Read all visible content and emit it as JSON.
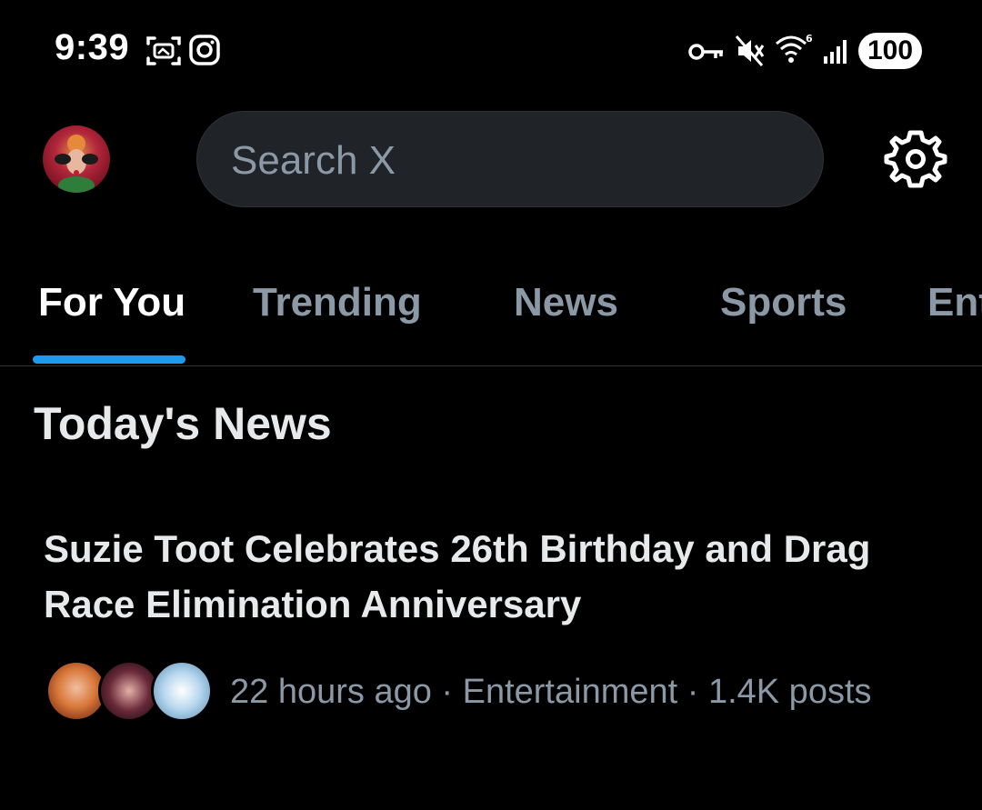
{
  "status_bar": {
    "time": "9:39",
    "battery": "100",
    "icons": [
      "screenshot-icon",
      "instagram-icon",
      "vpn-key-icon",
      "vibrate-off-icon",
      "wifi-6-icon",
      "signal-icon"
    ]
  },
  "header": {
    "search_placeholder": "Search X",
    "avatar_icon": "profile-avatar",
    "settings_icon": "gear-icon"
  },
  "tabs": [
    {
      "label": "For You",
      "active": true
    },
    {
      "label": "Trending",
      "active": false
    },
    {
      "label": "News",
      "active": false
    },
    {
      "label": "Sports",
      "active": false
    },
    {
      "label": "Ent",
      "active": false
    }
  ],
  "section": {
    "title": "Today's News"
  },
  "story": {
    "headline": "Suzie Toot Celebrates 26th Birthday and Drag Race Elimination Anniversary",
    "meta": "22 hours ago · Entertainment · 1.4K posts"
  },
  "colors": {
    "background": "#000000",
    "accent": "#1d9bf0",
    "muted_text": "#8b98a5",
    "primary_text": "#e7e9ea",
    "search_bg": "#202327"
  }
}
